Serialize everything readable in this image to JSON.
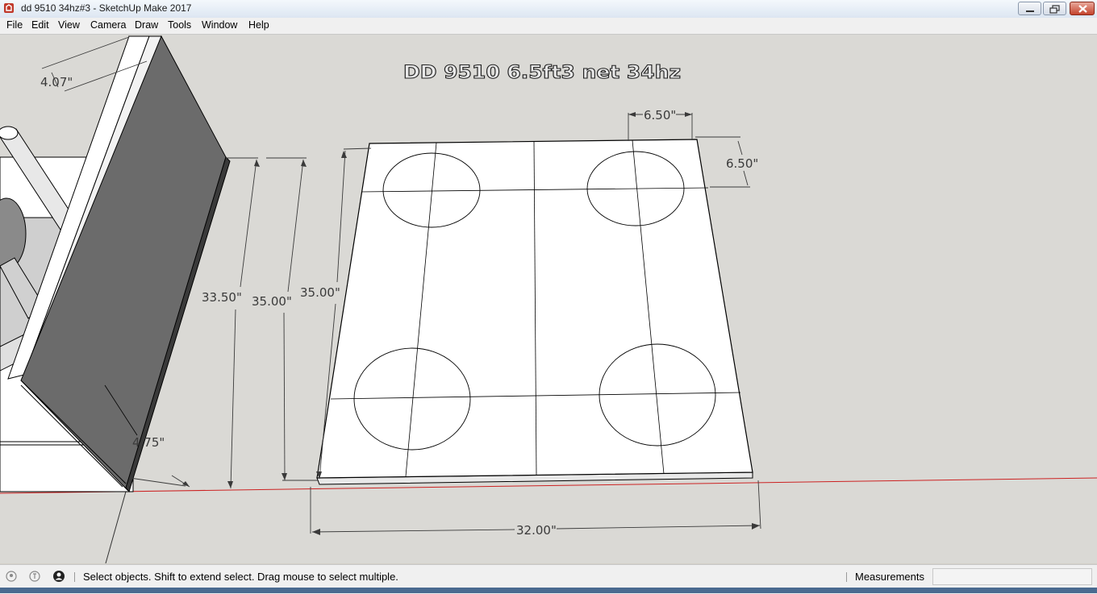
{
  "window": {
    "title": "dd 9510 34hz#3 - SketchUp Make 2017"
  },
  "menu": {
    "items": [
      "File",
      "Edit",
      "View",
      "Camera",
      "Draw",
      "Tools",
      "Window",
      "Help"
    ]
  },
  "model": {
    "text_label": "DD 9510 6.5ft3 net 34hz",
    "dimensions": {
      "top_left": "4.07\"",
      "hole_spacing_top": "6.50\"",
      "hole_spacing_right": "6.50\"",
      "height_a": "33.50\"",
      "height_b": "35.00\"",
      "height_c": "35.00\"",
      "depth": "4.75\"",
      "width": "32.00\""
    }
  },
  "status": {
    "hint": "Select objects. Shift to extend select. Drag mouse to select multiple.",
    "measurements_label": "Measurements",
    "measurements_value": ""
  },
  "colors": {
    "axis_red": "#cc2222",
    "board_gray": "#6b6b6b",
    "canvas_bg": "#dad9d5"
  }
}
